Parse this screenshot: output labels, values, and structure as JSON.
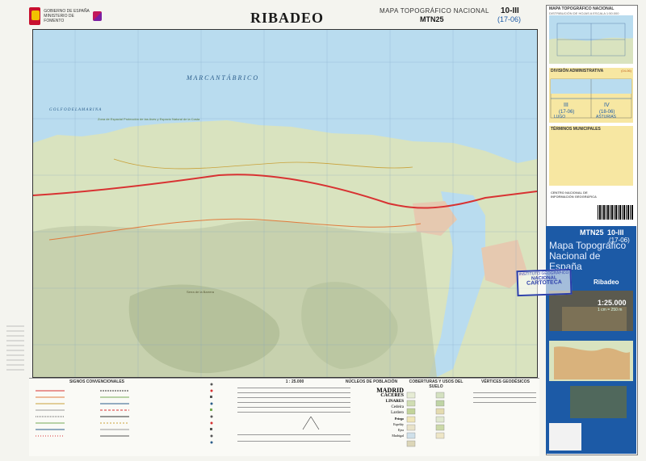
{
  "header": {
    "title": "RIBADEO",
    "series_title": "MAPA TOPOGRÁFICO NACIONAL",
    "series_code": "MTN25",
    "sheet_number": "10-III",
    "sheet_sub": "(17-06)",
    "logo_text_1": "GOBIERNO DE ESPAÑA",
    "logo_text_2": "MINISTERIO DE FOMENTO"
  },
  "map": {
    "sea_label": "M A R   C A N T Á B R I C O",
    "gulf_label": "G O L F O   D E   L A   M A R I N A",
    "park_label": "Zona de Espacial Protección de las Aves y Espacio Natural de la Costa",
    "sierra_label": "Serra de la Barrera"
  },
  "panel": {
    "index_title": "MAPA TOPOGRÁFICO NACIONAL",
    "index_sub": "DISTRIBUCIÓN DE HOJAS A ESCALA 1:50.000",
    "admin_title": "DIVISIÓN ADMINISTRATIVA",
    "admin_code": "(04-06)",
    "admin_lugo": "LUGO",
    "admin_asturias": "ASTURIAS",
    "admin_cell_1": "III",
    "admin_cell_1b": "(17-06)",
    "admin_cell_2": "IV",
    "admin_cell_2b": "(18-06)",
    "terms_title": "TÉRMINOS MUNICIPALES",
    "publisher_title": "CENTRO NACIONAL DE INFORMACIÓN GEOGRÁFICA"
  },
  "cover": {
    "code": "MTN25",
    "number": "10-III",
    "sub": "(17-06)",
    "title": "Mapa Topográfico Nacional de España",
    "place": "Ribadeo",
    "scale": "1:25.000",
    "scale_sub": "1 cm = 250 m"
  },
  "stamp": {
    "line1": "INSTITUTO GEOGRÁFICO",
    "line2": "NACIONAL",
    "line3": "CARTOTECA"
  },
  "legend": {
    "signs_title": "SIGNOS CONVENCIONALES",
    "scale_title": "1 : 25.000",
    "population_title": "NÚCLEOS DE POBLACIÓN",
    "cover_title": "COBERTURAS Y USOS DEL SUELO",
    "vertices_title": "VÉRTICES GEODÉSICOS",
    "towns": [
      "MADRID",
      "CÁCERES",
      "LINARES",
      "Cedeira",
      "Lardero",
      "Priego",
      "Espelúy",
      "Ejea",
      "Madrigal"
    ]
  },
  "colors": {
    "sea": "#b9dcef",
    "land": "#d9e3bf",
    "relief": "#c2ccaa",
    "road": "#d83232",
    "panel_blue": "#1c5aa6",
    "yellow": "#f7e7a2"
  }
}
